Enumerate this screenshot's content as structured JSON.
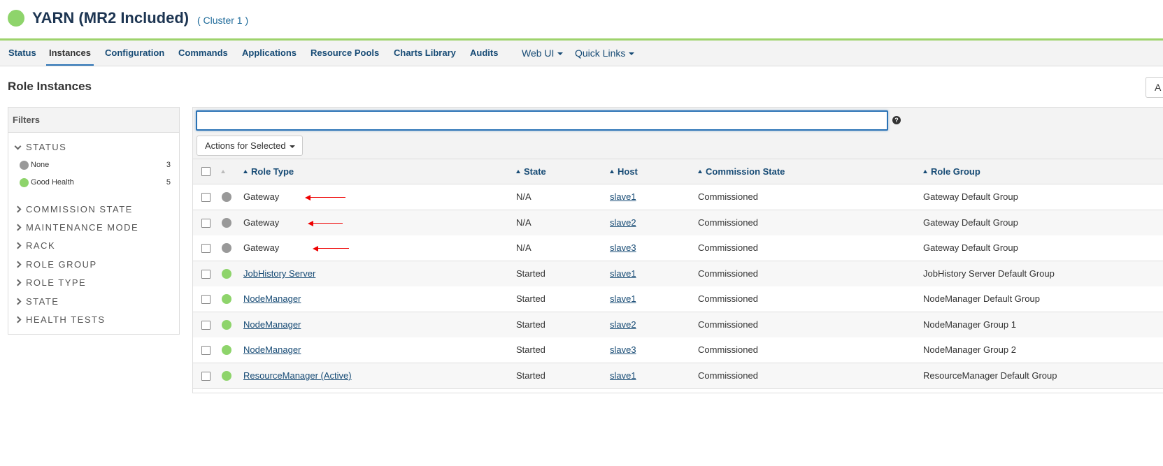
{
  "header": {
    "title": "YARN (MR2 Included)",
    "cluster": "( Cluster 1 )",
    "status_color": "#8ed46b"
  },
  "nav": {
    "items": [
      "Status",
      "Instances",
      "Configuration",
      "Commands",
      "Applications",
      "Resource Pools",
      "Charts Library",
      "Audits"
    ],
    "active": "Instances",
    "menus": [
      "Web UI",
      "Quick Links"
    ]
  },
  "page": {
    "title": "Role Instances",
    "add_button_label": "A"
  },
  "filters": {
    "title": "Filters",
    "status": {
      "label": "STATUS",
      "expanded": true,
      "options": [
        {
          "label": "None",
          "count": "3",
          "color": "#999999"
        },
        {
          "label": "Good Health",
          "count": "5",
          "color": "#8ed46b"
        }
      ]
    },
    "sections": [
      "COMMISSION STATE",
      "MAINTENANCE MODE",
      "RACK",
      "ROLE GROUP",
      "ROLE TYPE",
      "STATE",
      "HEALTH TESTS"
    ]
  },
  "search": {
    "value": "",
    "placeholder": "",
    "help_icon": "?"
  },
  "actions": {
    "label": "Actions for Selected"
  },
  "table": {
    "columns": [
      "Role Type",
      "State",
      "Host",
      "Commission State",
      "Role Group"
    ],
    "rows": [
      {
        "health": "none",
        "role_type": "Gateway",
        "role_link": false,
        "state": "N/A",
        "host": "slave1",
        "commission": "Commissioned",
        "group": "Gateway Default Group",
        "annotated": true
      },
      {
        "health": "none",
        "role_type": "Gateway",
        "role_link": false,
        "state": "N/A",
        "host": "slave2",
        "commission": "Commissioned",
        "group": "Gateway Default Group",
        "annotated": true
      },
      {
        "health": "none",
        "role_type": "Gateway",
        "role_link": false,
        "state": "N/A",
        "host": "slave3",
        "commission": "Commissioned",
        "group": "Gateway Default Group",
        "annotated": true
      },
      {
        "health": "good",
        "role_type": "JobHistory Server",
        "role_link": true,
        "state": "Started",
        "host": "slave1",
        "commission": "Commissioned",
        "group": "JobHistory Server Default Group",
        "annotated": false
      },
      {
        "health": "good",
        "role_type": "NodeManager",
        "role_link": true,
        "state": "Started",
        "host": "slave1",
        "commission": "Commissioned",
        "group": "NodeManager Default Group",
        "annotated": false
      },
      {
        "health": "good",
        "role_type": "NodeManager",
        "role_link": true,
        "state": "Started",
        "host": "slave2",
        "commission": "Commissioned",
        "group": "NodeManager Group 1",
        "annotated": false
      },
      {
        "health": "good",
        "role_type": "NodeManager",
        "role_link": true,
        "state": "Started",
        "host": "slave3",
        "commission": "Commissioned",
        "group": "NodeManager Group 2",
        "annotated": false
      },
      {
        "health": "good",
        "role_type": "ResourceManager (Active)",
        "role_link": true,
        "state": "Started",
        "host": "slave1",
        "commission": "Commissioned",
        "group": "ResourceManager Default Group",
        "annotated": false
      }
    ]
  },
  "colors": {
    "health_none": "#999999",
    "health_good": "#8ed46b",
    "link": "#174b75",
    "annotation_arrow": "#ee0000"
  }
}
